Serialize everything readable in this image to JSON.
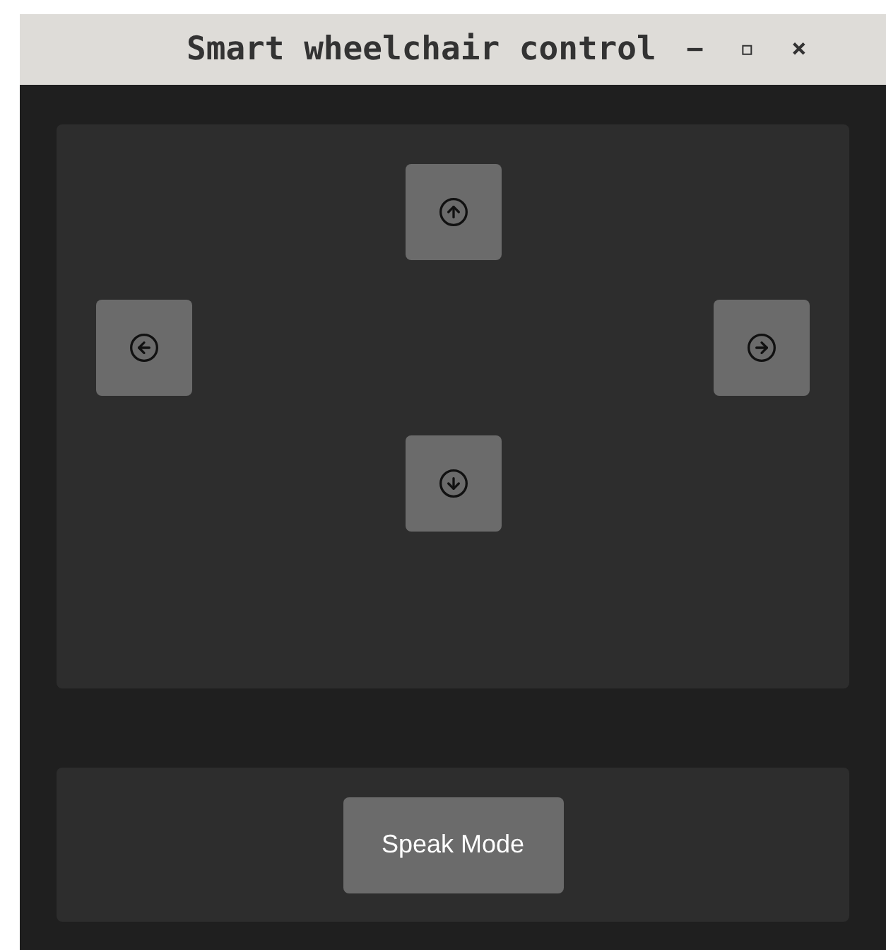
{
  "window": {
    "title": "Smart wheelchair control",
    "controls": [
      "–",
      "▫",
      "×"
    ]
  },
  "direction_pad": [
    {
      "kind": "up"
    },
    {
      "kind": "left"
    },
    {
      "kind": "right"
    },
    {
      "kind": "down"
    }
  ],
  "speak_button": {
    "label": "Speak Mode"
  }
}
